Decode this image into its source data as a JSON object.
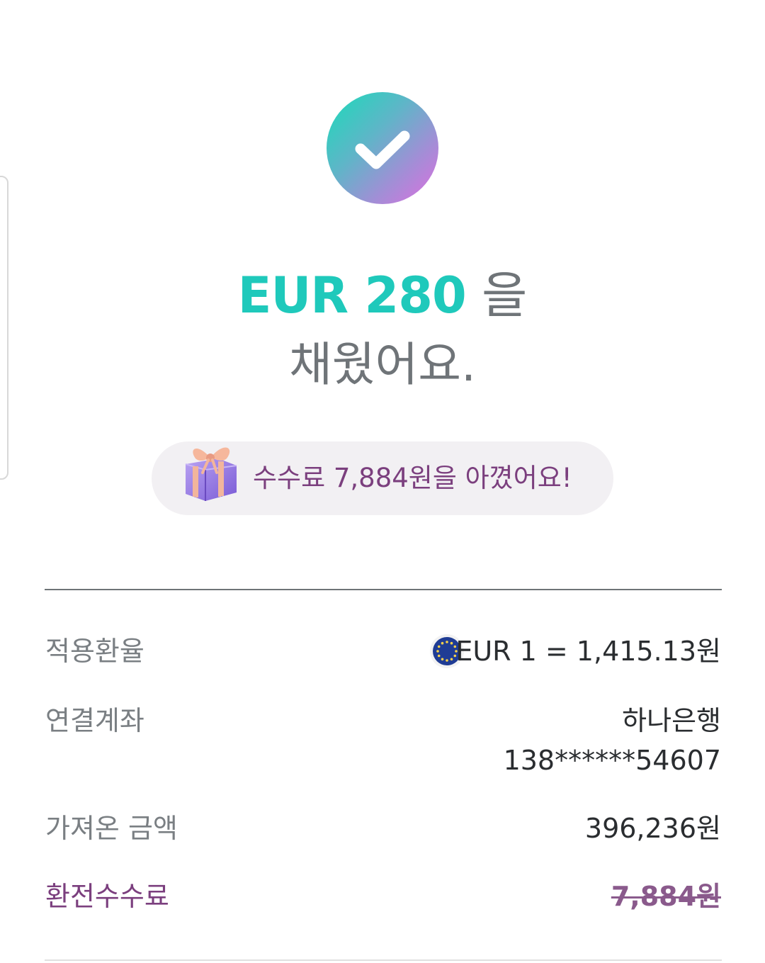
{
  "headline": {
    "amount": "EUR 280",
    "particle": "을",
    "line2": "채웠어요."
  },
  "savings_banner": {
    "text": "수수료 7,884원을 아꼈어요!",
    "icon": "gift-icon"
  },
  "details": {
    "rate_label": "적용환율",
    "rate_value": "EUR 1 = 1,415.13원",
    "rate_flag_icon": "eu-flag-icon",
    "account_label": "연결계좌",
    "account_bank": "하나은행",
    "account_number": "138******54607",
    "amount_label": "가져온 금액",
    "amount_value": "396,236원",
    "fee_label": "환전수수료",
    "fee_value": "7,884원"
  },
  "colors": {
    "accent_teal": "#1fc9bb",
    "accent_purple": "#7b3f7e",
    "text_gray": "#7a7f83"
  }
}
